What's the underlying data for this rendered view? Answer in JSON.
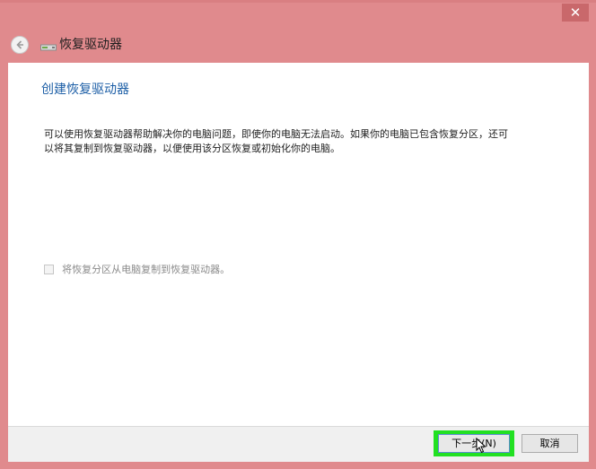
{
  "window": {
    "title": "恢复驱动器",
    "close_glyph": "✕",
    "accent_color": "#e08a8d"
  },
  "icons": {
    "back": "back-arrow-icon",
    "drive": "drive-icon",
    "close": "close-icon",
    "cursor": "mouse-cursor-icon"
  },
  "page": {
    "heading": "创建恢复驱动器",
    "description": "可以使用恢复驱动器帮助解决你的电脑问题，即使你的电脑无法启动。如果你的电脑已包含恢复分区，还可以将其复制到恢复驱动器，以便使用该分区恢复或初始化你的电脑。"
  },
  "option": {
    "copy_partition_label": "将恢复分区从电脑复制到恢复驱动器。",
    "checked": false,
    "enabled": false
  },
  "footer": {
    "next_label": "下一步(N)",
    "cancel_label": "取消",
    "highlight_color": "#22e022"
  }
}
